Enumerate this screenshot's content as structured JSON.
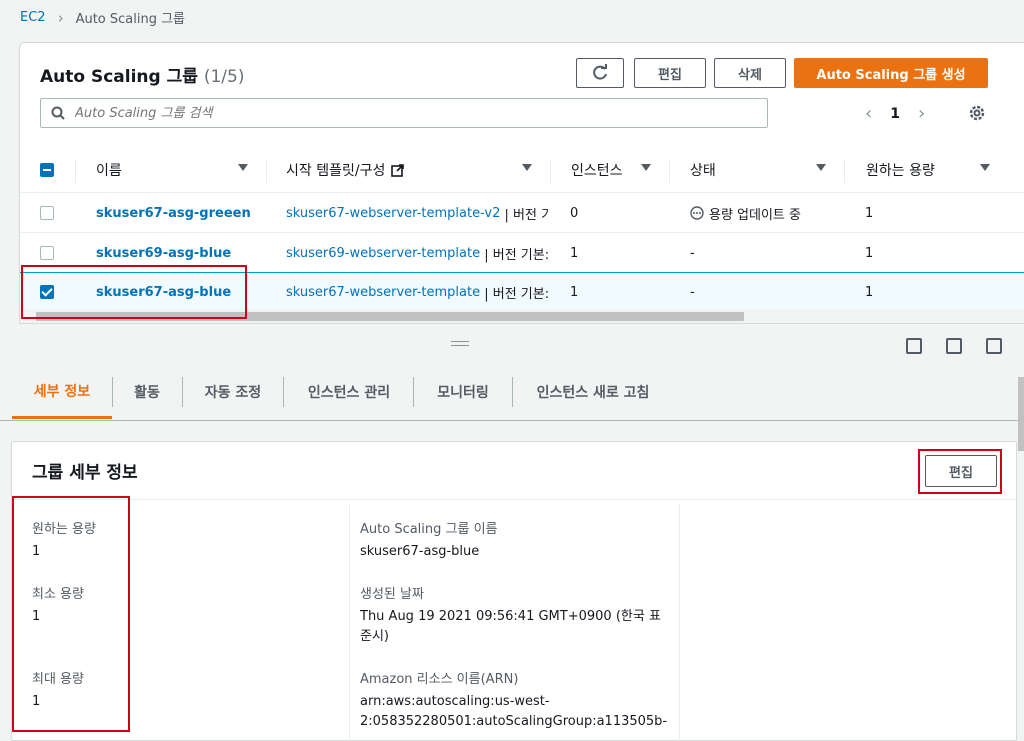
{
  "breadcrumb": {
    "root": "EC2",
    "current": "Auto Scaling 그룹"
  },
  "panel": {
    "title": "Auto Scaling 그룹",
    "count": "(1/5)"
  },
  "toolbar": {
    "edit": "편집",
    "delete": "삭제",
    "create": "Auto Scaling 그룹 생성"
  },
  "search": {
    "placeholder": "Auto Scaling 그룹 검색"
  },
  "pagination": {
    "page": "1"
  },
  "table": {
    "headers": {
      "name": "이름",
      "template": "시작 템플릿/구성",
      "instances": "인스턴스",
      "status": "상태",
      "desired": "원하는 용량"
    },
    "rows": [
      {
        "name": "skuser67-asg-greeen",
        "template": "skuser67-webserver-template-v2",
        "template_suffix": "| 버전 기",
        "instances": "0",
        "status": "용량 업데이트 중",
        "desired": "1",
        "checked": false
      },
      {
        "name": "skuser69-asg-blue",
        "template": "skuser69-webserver-template",
        "template_suffix": "| 버전 기본:",
        "instances": "1",
        "status": "-",
        "desired": "1",
        "checked": false
      },
      {
        "name": "skuser67-asg-blue",
        "template": "skuser67-webserver-template",
        "template_suffix": "| 버전 기본:",
        "instances": "1",
        "status": "-",
        "desired": "1",
        "checked": true
      }
    ]
  },
  "tabs": [
    "세부 정보",
    "활동",
    "자동 조정",
    "인스턴스 관리",
    "모니터링",
    "인스턴스 새로 고침"
  ],
  "details": {
    "title": "그룹 세부 정보",
    "edit": "편집",
    "desired_label": "원하는 용량",
    "desired_value": "1",
    "min_label": "최소 용량",
    "min_value": "1",
    "max_label": "최대 용량",
    "max_value": "1",
    "asg_name_label": "Auto Scaling 그룹 이름",
    "asg_name_value": "skuser67-asg-blue",
    "created_label": "생성된 날짜",
    "created_value_1": "Thu Aug 19 2021 09:56:41 GMT+0900 (한국 표",
    "created_value_2": "준시)",
    "arn_label": "Amazon 리소스 이름(ARN)",
    "arn_value_1": "arn:aws:autoscaling:us-west-",
    "arn_value_2": "2:058352280501:autoScalingGroup:a113505b-"
  },
  "colors": {
    "accent": "#ec7211",
    "link": "#0073bb",
    "highlight": "#d0021b"
  }
}
